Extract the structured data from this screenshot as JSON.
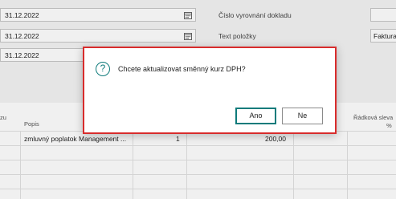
{
  "header": {
    "dates": [
      "31.12.2022",
      "31.12.2022",
      "31.12.2022"
    ],
    "right_labels": [
      "Číslo vyrovnání dokladu",
      "Text položky"
    ],
    "right_values": [
      "",
      "Faktura"
    ]
  },
  "grid": {
    "headers": {
      "col0": "zu",
      "popis": "Popis",
      "radkova_sleva": "Řádková sleva",
      "percent": "%"
    },
    "rows": [
      {
        "popis": "zmluvný poplatok Management ...",
        "qty": "1",
        "amount": "200,00"
      }
    ]
  },
  "dialog": {
    "icon": "question-icon",
    "message": "Chcete aktualizovat směnný kurz DPH?",
    "yes_label": "Ano",
    "no_label": "Ne",
    "border_color": "#d82c2c",
    "accent_color": "#0e7b7b"
  }
}
